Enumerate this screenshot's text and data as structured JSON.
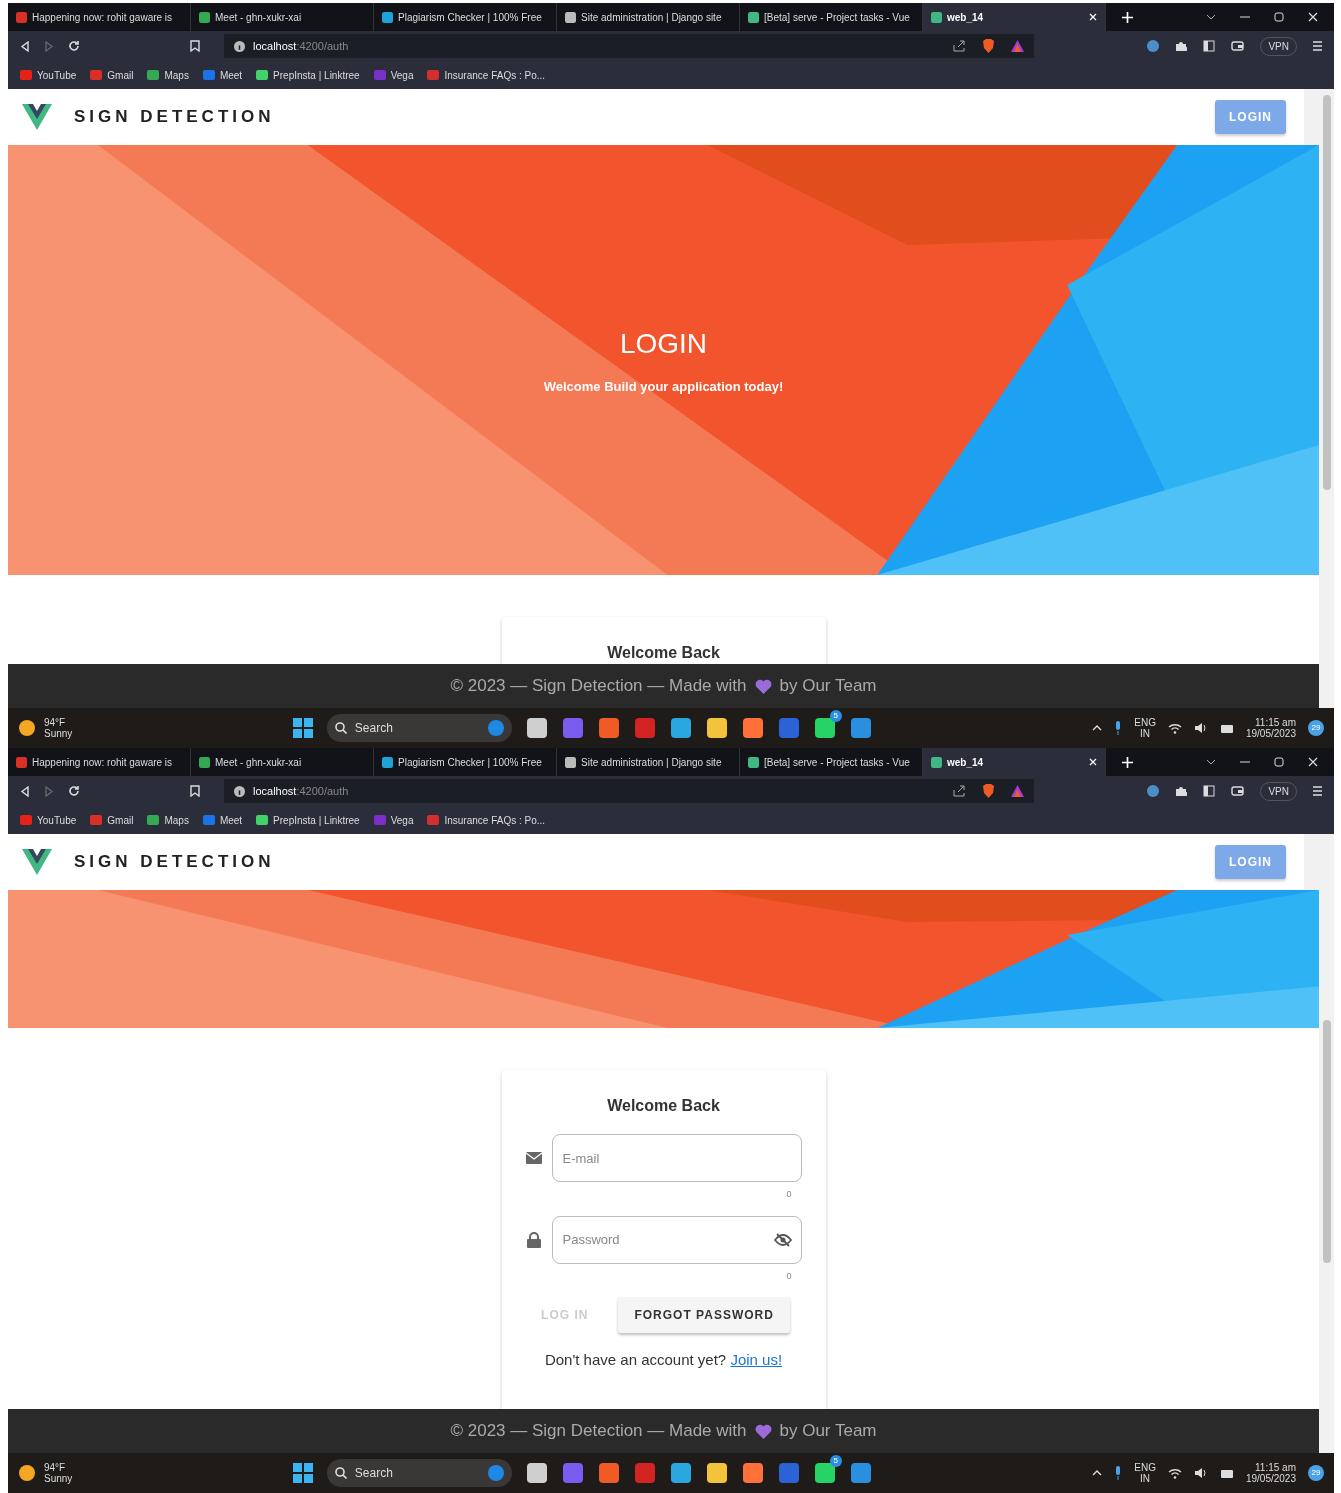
{
  "screens": [
    {
      "browser": {
        "tabs": [
          {
            "label": "Happening now: rohit gaware is",
            "selected": false
          },
          {
            "label": "Meet - ghn-xukr-xai",
            "selected": false
          },
          {
            "label": "Plagiarism Checker | 100% Free",
            "selected": false
          },
          {
            "label": "Site administration | Django site",
            "selected": false
          },
          {
            "label": "[Beta] serve - Project tasks - Vue",
            "selected": false
          },
          {
            "label": "web_14",
            "selected": true
          }
        ],
        "url": "**localhost**:4200/auth",
        "vpn": "VPN",
        "bookmarks": [
          "YouTube",
          "Gmail",
          "Maps",
          "Meet",
          "PrepInsta | Linktree",
          "Vega",
          "Insurance FAQs : Po..."
        ]
      },
      "app": {
        "brand": "SIGN DETECTION",
        "login_button": "LOGIN",
        "hero": {
          "title": "LOGIN",
          "subtitle": "Welcome Build your application today!"
        },
        "card": {
          "title": "Welcome Back"
        },
        "footer": {
          "before": "© 2023 — Sign Detection — Made with",
          "after": "by Our Team"
        }
      },
      "taskbar": {
        "temperature": "94°F",
        "weather": "Sunny",
        "search": "Search",
        "chat_badge": "5",
        "language": "ENG",
        "region": "IN",
        "time": "11:15 am",
        "date": "19/05/2023",
        "notifications": "29"
      }
    },
    {
      "browser": {
        "tabs": [
          {
            "label": "Happening now: rohit gaware is",
            "selected": false
          },
          {
            "label": "Meet - ghn-xukr-xai",
            "selected": false
          },
          {
            "label": "Plagiarism Checker | 100% Free",
            "selected": false
          },
          {
            "label": "Site administration | Django site",
            "selected": false
          },
          {
            "label": "[Beta] serve - Project tasks - Vue",
            "selected": false
          },
          {
            "label": "web_14",
            "selected": true
          }
        ],
        "url": "**localhost**:4200/auth",
        "vpn": "VPN",
        "bookmarks": [
          "YouTube",
          "Gmail",
          "Maps",
          "Meet",
          "PrepInsta | Linktree",
          "Vega",
          "Insurance FAQs : Po..."
        ]
      },
      "app": {
        "brand": "SIGN DETECTION",
        "login_button": "LOGIN",
        "card": {
          "title": "Welcome Back",
          "email": {
            "placeholder": "E-mail",
            "counter": "0"
          },
          "password": {
            "placeholder": "Password",
            "counter": "0"
          },
          "login": {
            "label": "LOG IN",
            "disabled": true
          },
          "forgot": "FORGOT PASSWORD",
          "signup": {
            "text": "Don't have an account yet?",
            "link": "Join us!"
          }
        },
        "footer": {
          "before": "© 2023 — Sign Detection — Made with",
          "after": "by Our Team"
        }
      },
      "taskbar": {
        "temperature": "94°F",
        "weather": "Sunny",
        "search": "Search",
        "chat_badge": "5",
        "language": "ENG",
        "region": "IN",
        "time": "11:15 am",
        "date": "19/05/2023",
        "notifications": "29"
      }
    }
  ]
}
